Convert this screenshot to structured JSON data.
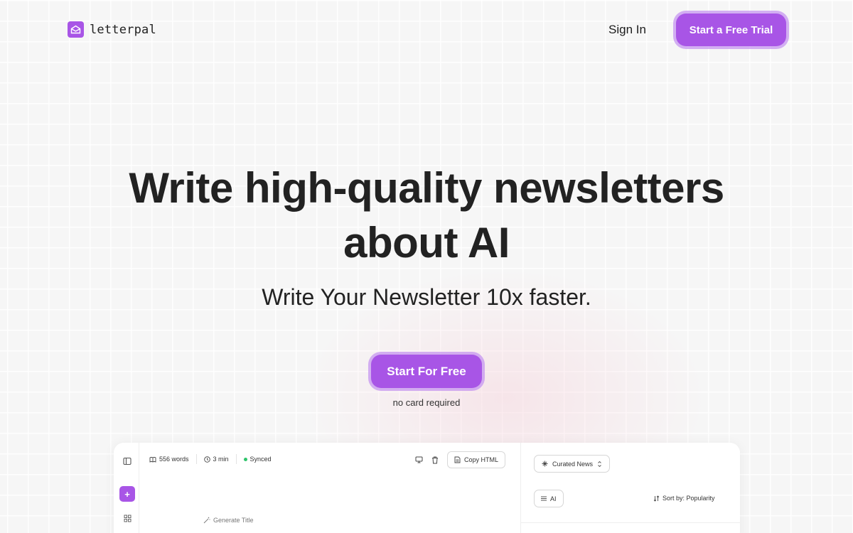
{
  "header": {
    "logo_text": "letterpal",
    "signin_label": "Sign In",
    "trial_label": "Start a Free Trial"
  },
  "hero": {
    "title_regular_1": "Write ",
    "title_bold_1": "high-quality newsletters",
    "title_regular_2": "about ",
    "title_bold_2": "AI",
    "subtitle": "Write Your Newsletter 10x faster.",
    "cta_label": "Start For Free",
    "cta_note": "no card required"
  },
  "app_preview": {
    "words": "556 words",
    "read_time": "3 min",
    "sync_status": "Synced",
    "copy_html_label": "Copy HTML",
    "generate_title_label": "Generate Title",
    "source_select": "Curated News",
    "filter_chip": "AI",
    "sort_label": "Sort by: Popularity"
  },
  "colors": {
    "accent": "#a855e6",
    "accent_ring": "#c596f0",
    "synced_dot": "#2fc46b",
    "background": "#f6f6f6"
  },
  "icons": [
    "mail-open-icon",
    "sidebar-toggle-icon",
    "plus-icon",
    "grid-icon",
    "book-icon",
    "clock-icon",
    "monitor-icon",
    "trash-icon",
    "document-icon",
    "wand-icon",
    "sparkle-icon",
    "chevron-updown-icon",
    "list-icon",
    "sort-icon"
  ]
}
